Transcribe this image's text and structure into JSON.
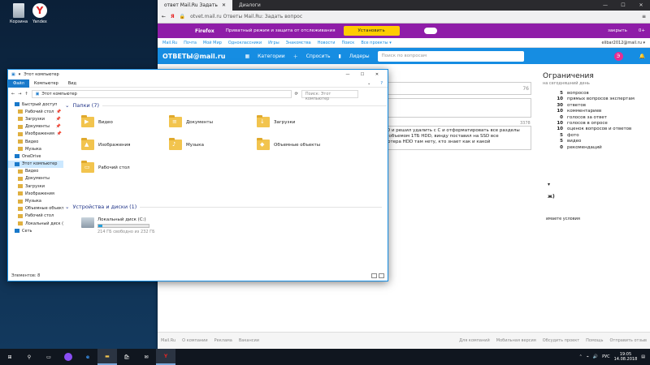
{
  "desktop": {
    "icons": [
      {
        "label": "Корзина",
        "icon": "recycle-bin-icon"
      },
      {
        "label": "Yandex",
        "icon": "yandex-browser-icon"
      }
    ]
  },
  "browser": {
    "tabs": [
      "ответ Mail.Ru Задать вопрос",
      "Диалоги"
    ],
    "url": "otvet.mail.ru Ответы Mail.Ru: Задать вопрос",
    "private_bar": {
      "brand": "Firefox",
      "text": "Приватный режим и защита от отслеживания",
      "button": "Установить",
      "close": "закрыть",
      "count": "0+"
    },
    "mail_nav": [
      "Mail.Ru",
      "Почта",
      "Мой Мир",
      "Одноклассники",
      "Игры",
      "Знакомства",
      "Новости",
      "Поиск",
      "Все проекты ▾"
    ],
    "account": "elibar2012@mail.ru ▾",
    "otvet_header": {
      "logo": "ОТВЕТЫ@mail.ru",
      "categories": "Категории",
      "ask": "Спросить",
      "leaders": "Лидеры",
      "search_placeholder": "Поиск по вопросам",
      "avatar_letter": "Э"
    },
    "form": {
      "counter1": "76",
      "counter2": "3378",
      "text_line1": "SSD и решил удалить с С и отформатировать все разделы",
      "text_line2": "им объемом 1ТБ HDD, винду поставил на SSD все",
      "text_line3": "пьютера HDD там нету, кто знает как и какой",
      "terms": "имаете условия"
    },
    "limits": {
      "title": "Ограничения",
      "subtitle": "на сегодняшний день",
      "rows": [
        {
          "n": "5",
          "label": "вопросов"
        },
        {
          "n": "10",
          "label": "прямых вопросов экспертам"
        },
        {
          "n": "30",
          "label": "ответов"
        },
        {
          "n": "10",
          "label": "комментариев"
        },
        {
          "n": "0",
          "label": "голосов за ответ"
        },
        {
          "n": "10",
          "label": "голосов в опросе"
        },
        {
          "n": "10",
          "label": "оценок вопросов и ответов"
        },
        {
          "n": "5",
          "label": "фото"
        },
        {
          "n": "5",
          "label": "видео"
        },
        {
          "n": "0",
          "label": "рекомендаций"
        }
      ]
    },
    "footer_left": [
      "Mail.Ru",
      "О компании",
      "Реклама",
      "Вакансии"
    ],
    "footer_right": [
      "Для компаний",
      "Мобильная версия",
      "Обсудить проект",
      "Помощь",
      "Отправить отзыв"
    ]
  },
  "explorer": {
    "title": "Этот компьютер",
    "ribbon": [
      "Файл",
      "Компьютер",
      "Вид"
    ],
    "path": "Этот компьютер",
    "search_placeholder": "Поиск: Этот компьютер",
    "nav": [
      {
        "label": "Быстрый доступ",
        "level": 0,
        "pin": false
      },
      {
        "label": "Рабочий стол",
        "level": 1,
        "pin": true
      },
      {
        "label": "Загрузки",
        "level": 1,
        "pin": true
      },
      {
        "label": "Документы",
        "level": 1,
        "pin": true
      },
      {
        "label": "Изображения",
        "level": 1,
        "pin": true
      },
      {
        "label": "Видео",
        "level": 1,
        "pin": false
      },
      {
        "label": "Музыка",
        "level": 1,
        "pin": false
      },
      {
        "label": "OneDrive",
        "level": 0,
        "pin": false
      },
      {
        "label": "Этот компьютер",
        "level": 0,
        "pin": false,
        "selected": true
      },
      {
        "label": "Видео",
        "level": 1,
        "pin": false
      },
      {
        "label": "Документы",
        "level": 1,
        "pin": false
      },
      {
        "label": "Загрузки",
        "level": 1,
        "pin": false
      },
      {
        "label": "Изображения",
        "level": 1,
        "pin": false
      },
      {
        "label": "Музыка",
        "level": 1,
        "pin": false
      },
      {
        "label": "Объемные объекты",
        "level": 1,
        "pin": false
      },
      {
        "label": "Рабочий стол",
        "level": 1,
        "pin": false
      },
      {
        "label": "Локальный диск (C",
        "level": 1,
        "pin": false
      },
      {
        "label": "Сеть",
        "level": 0,
        "pin": false
      }
    ],
    "folders_header": "Папки (7)",
    "folders": [
      "Видео",
      "Документы",
      "Загрузки",
      "Изображения",
      "Музыка",
      "Объемные объекты",
      "Рабочий стол"
    ],
    "devices_header": "Устройства и диски (1)",
    "drive": {
      "name": "Локальный диск (C:)",
      "free": "214 ГБ свободно из 232 ГБ",
      "used_fraction": 0.08
    },
    "status": "Элементов: 8"
  },
  "taskbar": {
    "lang": "РУС",
    "time": "19:05",
    "date": "14.08.2018"
  }
}
